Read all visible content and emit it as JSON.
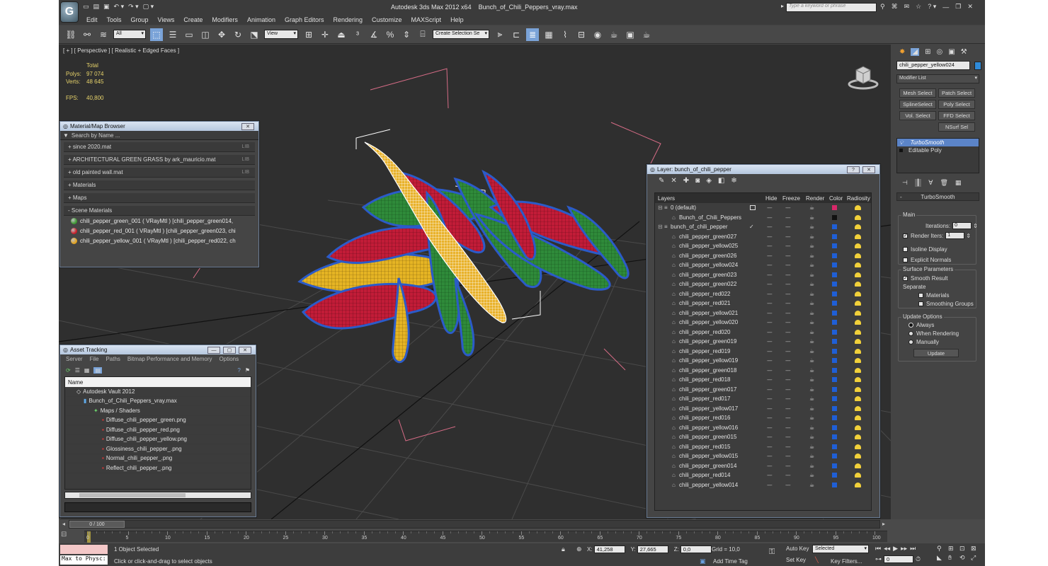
{
  "titlebar": {
    "app": "Autodesk 3ds Max  2012 x64",
    "file": "Bunch_of_Chili_Peppers_vray.max",
    "search_placeholder": "Type a keyword or phrase"
  },
  "menus": [
    "Edit",
    "Tools",
    "Group",
    "Views",
    "Create",
    "Modifiers",
    "Animation",
    "Graph Editors",
    "Rendering",
    "Customize",
    "MAXScript",
    "Help"
  ],
  "toolbar": {
    "filter": "All",
    "ref_coord": "View",
    "selection_set": "Create Selection Se"
  },
  "viewport": {
    "label": "[ + ] [ Perspective ] [ Realistic + Edged Faces ]",
    "stats": {
      "total_label": "Total",
      "polys_label": "Polys:",
      "polys": "97 074",
      "verts_label": "Verts:",
      "verts": "48 645",
      "fps_label": "FPS:",
      "fps": "40,800"
    }
  },
  "material_browser": {
    "title": "Material/Map Browser",
    "search_placeholder": "Search by Name ...",
    "libraries": [
      {
        "name": "+ since 2020.mat",
        "tag": "LIB"
      },
      {
        "name": "+ ARCHITECTURAL GREEN GRASS by ark_mauricio.mat",
        "tag": "LIB"
      },
      {
        "name": "+ old painted wall.mat",
        "tag": "LIB"
      },
      {
        "name": "+ Materials",
        "tag": ""
      },
      {
        "name": "+ Maps",
        "tag": ""
      },
      {
        "name": "- Scene Materials",
        "tag": ""
      }
    ],
    "scene_materials": [
      {
        "name": "chili_pepper_green_001  ( VRayMtl )  [chili_pepper_green014,",
        "color": "#3f9a34"
      },
      {
        "name": "chili_pepper_red_001  ( VRayMtl )  [chili_pepper_green023, chi",
        "color": "#c8202a"
      },
      {
        "name": "chili_pepper_yellow_001  ( VRayMtl )  [chili_pepper_red022, ch",
        "color": "#e2a21f"
      }
    ]
  },
  "asset_tracking": {
    "title": "Asset Tracking",
    "menus": [
      "Server",
      "File",
      "Paths",
      "Bitmap Performance and Memory",
      "Options"
    ],
    "column": "Name",
    "rows": [
      {
        "name": "Autodesk Vault 2012",
        "indent": 0
      },
      {
        "name": "Bunch_of_Chili_Peppers_vray.max",
        "indent": 1
      },
      {
        "name": "Maps / Shaders",
        "indent": 2
      },
      {
        "name": "Diffuse_chili_pepper_green.png",
        "indent": 3
      },
      {
        "name": "Diffuse_chili_pepper_red.png",
        "indent": 3
      },
      {
        "name": "Diffuse_chili_pepper_yellow.png",
        "indent": 3
      },
      {
        "name": "Glossiness_chili_pepper_.png",
        "indent": 3
      },
      {
        "name": "Normal_chili_pepper_.png",
        "indent": 3
      },
      {
        "name": "Reflect_chili_pepper_.png",
        "indent": 3
      }
    ]
  },
  "layer_window": {
    "title": "Layer: bunch_of_chili_pepper",
    "columns": [
      "Layers",
      "Hide",
      "Freeze",
      "Render",
      "Color",
      "Radiosity"
    ],
    "rows": [
      {
        "name": "0 (default)",
        "indent": 0,
        "color": "#d8286a"
      },
      {
        "name": "Bunch_of_Chili_Peppers",
        "indent": 1,
        "color": "#111111"
      },
      {
        "name": "bunch_of_chili_pepper",
        "indent": 0,
        "color": "#1f5fd6"
      },
      {
        "name": "chili_pepper_green027",
        "indent": 1,
        "color": "#1f5fd6"
      },
      {
        "name": "chili_pepper_yellow025",
        "indent": 1,
        "color": "#1f5fd6"
      },
      {
        "name": "chili_pepper_green026",
        "indent": 1,
        "color": "#1f5fd6"
      },
      {
        "name": "chili_pepper_yellow024",
        "indent": 1,
        "color": "#1f5fd6"
      },
      {
        "name": "chili_pepper_green023",
        "indent": 1,
        "color": "#1f5fd6"
      },
      {
        "name": "chili_pepper_green022",
        "indent": 1,
        "color": "#1f5fd6"
      },
      {
        "name": "chili_pepper_red022",
        "indent": 1,
        "color": "#1f5fd6"
      },
      {
        "name": "chili_pepper_red021",
        "indent": 1,
        "color": "#1f5fd6"
      },
      {
        "name": "chili_pepper_yellow021",
        "indent": 1,
        "color": "#1f5fd6"
      },
      {
        "name": "chili_pepper_yellow020",
        "indent": 1,
        "color": "#1f5fd6"
      },
      {
        "name": "chili_pepper_red020",
        "indent": 1,
        "color": "#1f5fd6"
      },
      {
        "name": "chili_pepper_green019",
        "indent": 1,
        "color": "#1f5fd6"
      },
      {
        "name": "chili_pepper_red019",
        "indent": 1,
        "color": "#1f5fd6"
      },
      {
        "name": "chili_pepper_yellow019",
        "indent": 1,
        "color": "#1f5fd6"
      },
      {
        "name": "chili_pepper_green018",
        "indent": 1,
        "color": "#1f5fd6"
      },
      {
        "name": "chili_pepper_red018",
        "indent": 1,
        "color": "#1f5fd6"
      },
      {
        "name": "chili_pepper_green017",
        "indent": 1,
        "color": "#1f5fd6"
      },
      {
        "name": "chili_pepper_red017",
        "indent": 1,
        "color": "#1f5fd6"
      },
      {
        "name": "chili_pepper_yellow017",
        "indent": 1,
        "color": "#1f5fd6"
      },
      {
        "name": "chili_pepper_red016",
        "indent": 1,
        "color": "#1f5fd6"
      },
      {
        "name": "chili_pepper_yellow016",
        "indent": 1,
        "color": "#1f5fd6"
      },
      {
        "name": "chili_pepper_green015",
        "indent": 1,
        "color": "#1f5fd6"
      },
      {
        "name": "chili_pepper_red015",
        "indent": 1,
        "color": "#1f5fd6"
      },
      {
        "name": "chili_pepper_yellow015",
        "indent": 1,
        "color": "#1f5fd6"
      },
      {
        "name": "chili_pepper_green014",
        "indent": 1,
        "color": "#1f5fd6"
      },
      {
        "name": "chili_pepper_red014",
        "indent": 1,
        "color": "#1f5fd6"
      },
      {
        "name": "chili_pepper_yellow014",
        "indent": 1,
        "color": "#1f5fd6"
      }
    ]
  },
  "command_panel": {
    "object_name": "chili_pepper_yellow024",
    "modifier_list": "Modifier List",
    "buttons": [
      "Mesh Select",
      "Patch Select",
      "SplineSelect",
      "Poly Select",
      "Vol. Select",
      "FFD Select",
      "NSurf Sel"
    ],
    "stack": [
      "TurboSmooth",
      "Editable Poly"
    ],
    "rollout_title": "TurboSmooth",
    "main_label": "Main",
    "iterations_label": "Iterations:",
    "iterations": "0",
    "render_iters_label": "Render Iters:",
    "render_iters": "1",
    "isoline": "Isoline Display",
    "explicit": "Explicit Normals",
    "surface_label": "Surface Parameters",
    "smooth": "Smooth Result",
    "separate": "Separate",
    "materials": "Materials",
    "smoothing": "Smoothing Groups",
    "update_options": "Update Options",
    "always": "Always",
    "when_rendering": "When Rendering",
    "manually": "Manually",
    "update_button": "Update"
  },
  "timeline": {
    "frame": "0 / 100",
    "ticks": [
      "0",
      "5",
      "10",
      "15",
      "20",
      "25",
      "30",
      "35",
      "40",
      "45",
      "50",
      "55",
      "60",
      "65",
      "70",
      "75",
      "80",
      "85",
      "90",
      "95",
      "100"
    ]
  },
  "status": {
    "maxscript": "Max to Physc:",
    "selected": "1 Object Selected",
    "prompt": "Click or click-and-drag to select objects",
    "x_label": "X:",
    "x": "41,258",
    "y_label": "Y:",
    "y": "27,665",
    "z_label": "Z:",
    "z": "0,0",
    "grid": "Grid = 10,0",
    "add_time_tag": "Add Time Tag",
    "auto_key": "Auto Key",
    "set_key": "Set Key",
    "selected_dropdown": "Selected",
    "key_filters": "Key Filters...",
    "frame_field": "0"
  }
}
